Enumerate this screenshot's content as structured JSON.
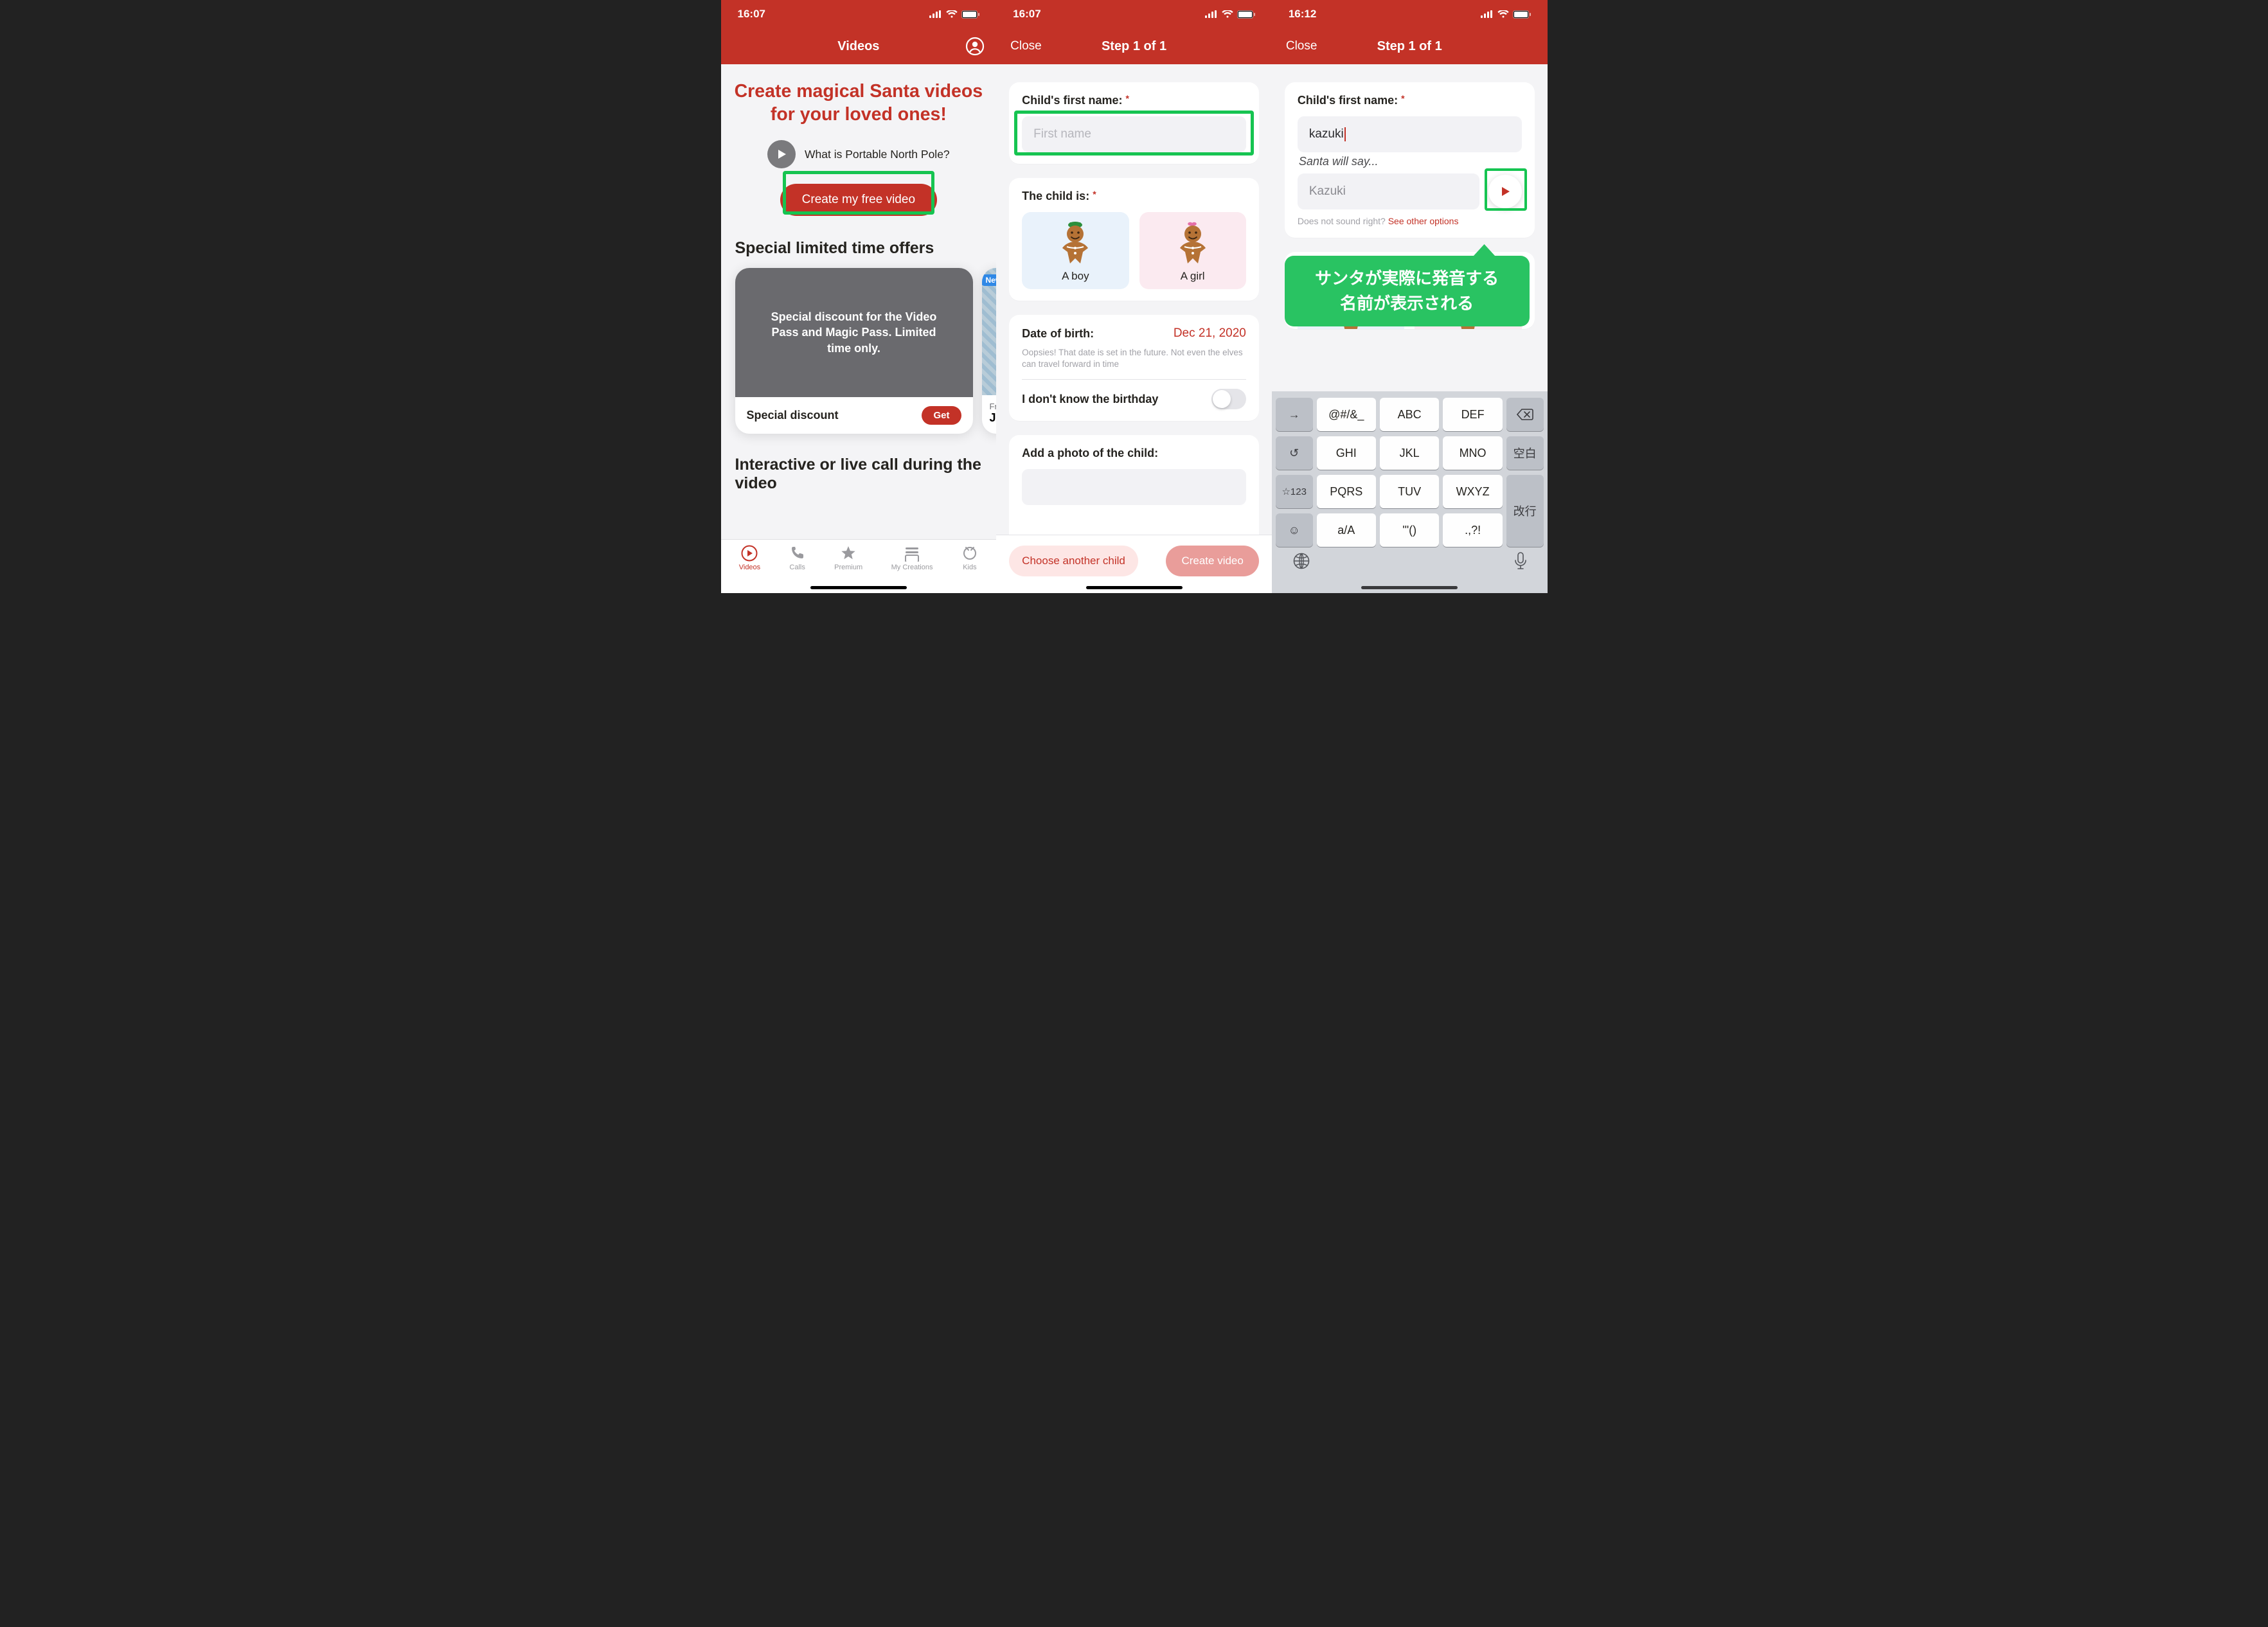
{
  "screen1": {
    "time": "16:07",
    "nav_title": "Videos",
    "hero": "Create magical Santa videos for your loved ones!",
    "what_is": "What is Portable North Pole?",
    "cta": "Create my free video",
    "offers_heading": "Special limited time offers",
    "offer_card": {
      "banner": "Special discount for the Video Pass and Magic Pass. Limited time only.",
      "title": "Special discount",
      "button": "Get"
    },
    "peek": {
      "badge": "New",
      "free": "Free",
      "ju": "Ju"
    },
    "second_heading": "Interactive or live call during the video",
    "tabs": [
      "Videos",
      "Calls",
      "Premium",
      "My Creations",
      "Kids"
    ]
  },
  "screen2": {
    "time": "16:07",
    "nav_close": "Close",
    "nav_title": "Step 1 of 1",
    "first_name_label": "Child's first name:",
    "first_name_placeholder": "First name",
    "gender_label": "The child is:",
    "gender_boy": "A boy",
    "gender_girl": "A girl",
    "dob_label": "Date of birth:",
    "dob_value": "Dec 21, 2020",
    "dob_hint": "Oopsies! That date is set in the future. Not even the elves can travel forward in time",
    "unknown_bday": "I don't know the birthday",
    "photo_label": "Add a photo of the child:",
    "choose": "Choose another child",
    "create": "Create video"
  },
  "screen3": {
    "time": "16:12",
    "nav_close": "Close",
    "nav_title": "Step 1 of 1",
    "first_name_label": "Child's first name:",
    "first_name_value": "kazuki",
    "say_label": "Santa will say...",
    "say_value": "Kazuki",
    "sound_hint_pre": "Does not sound right?  ",
    "sound_hint_link": "See other options",
    "annotation_l1": "サンタが実際に発音する",
    "annotation_l2": "名前が表示される",
    "keyboard": {
      "row1": [
        "→",
        "@#/&_",
        "ABC",
        "DEF",
        "⌫"
      ],
      "row2": [
        "↺",
        "GHI",
        "JKL",
        "MNO",
        "空白"
      ],
      "row3": [
        "☆123",
        "PQRS",
        "TUV",
        "WXYZ",
        "改行"
      ],
      "row4": [
        "☺",
        "a/A",
        "'\"()",
        ".,?!",
        ""
      ]
    }
  }
}
